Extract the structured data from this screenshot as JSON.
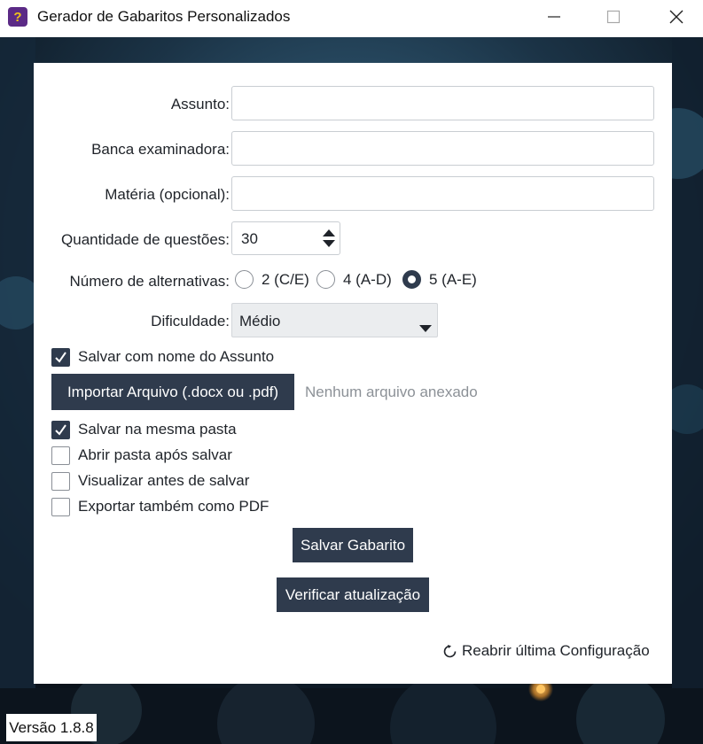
{
  "window": {
    "title": "Gerador de Gabaritos Personalizados",
    "icon_glyph": "?"
  },
  "form": {
    "assunto_label": "Assunto:",
    "assunto_value": "",
    "banca_label": "Banca examinadora:",
    "banca_value": "",
    "materia_label": "Matéria (opcional):",
    "materia_value": "",
    "quantidade_label": "Quantidade de questões:",
    "quantidade_value": "30",
    "alternativas_label": "Número de alternativas:",
    "alternativas_options": [
      {
        "label": "2 (C/E)",
        "selected": false
      },
      {
        "label": "4 (A-D)",
        "selected": false
      },
      {
        "label": "5 (A-E)",
        "selected": true
      }
    ],
    "dificuldade_label": "Dificuldade:",
    "dificuldade_value": "Médio",
    "salvar_nome_assunto": {
      "label": "Salvar com nome do Assunto",
      "checked": true
    },
    "importar_button": "Importar Arquivo (.docx ou .pdf)",
    "arquivo_status": "Nenhum arquivo anexado",
    "options": [
      {
        "label": "Salvar na mesma pasta",
        "checked": true
      },
      {
        "label": "Abrir pasta após salvar",
        "checked": false
      },
      {
        "label": "Visualizar antes de salvar",
        "checked": false
      },
      {
        "label": "Exportar também como PDF",
        "checked": false
      }
    ],
    "salvar_button": "Salvar Gabarito",
    "verificar_button": "Verificar atualização",
    "reabrir_link": "Reabrir última Configuração"
  },
  "version": "Versão 1.8.8",
  "colors": {
    "button_bg": "#2f3b4d",
    "panel_bg": "#ffffff",
    "muted_text": "#8c9197",
    "icon_bg": "#5b2a86",
    "icon_glyph": "#f0c419"
  },
  "icons": {
    "app": "question-mark-icon",
    "minimize": "minimize-icon",
    "maximize": "maximize-icon",
    "close": "close-icon",
    "spin": "spin-arrows-icon",
    "dropdown": "chevron-down-icon",
    "check": "checkmark-icon",
    "reopen": "refresh-icon"
  }
}
